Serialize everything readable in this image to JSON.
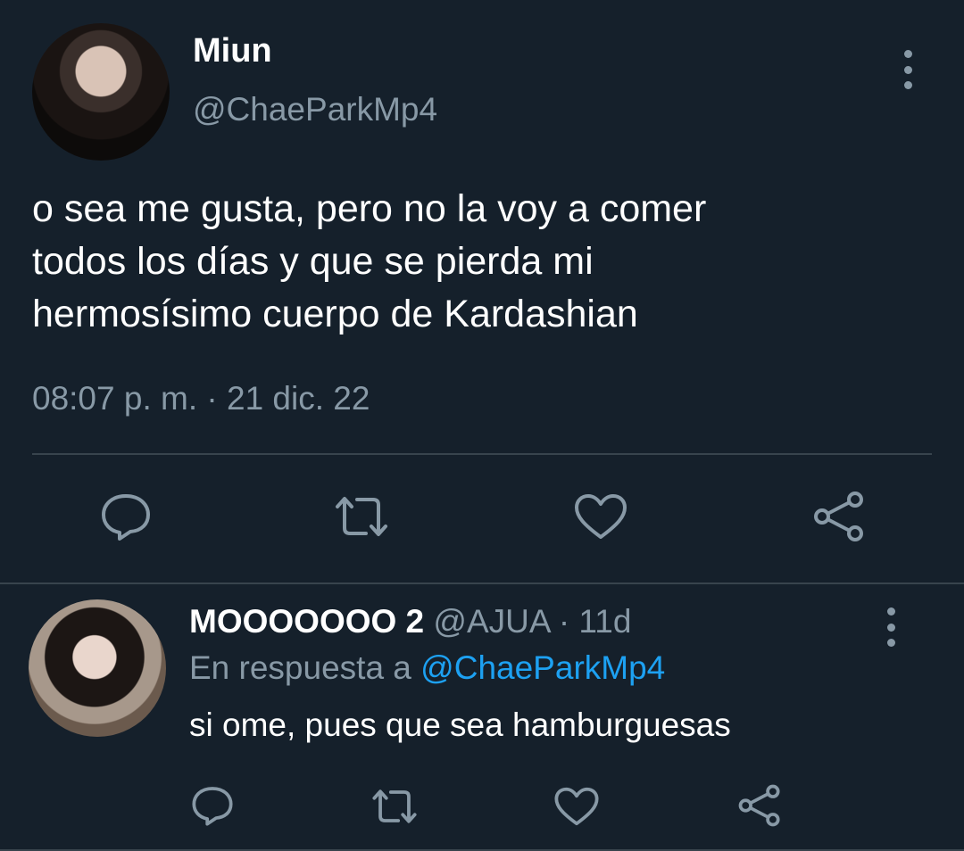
{
  "main_tweet": {
    "display_name": "Miun",
    "handle": "@ChaeParkMp4",
    "text_lines": [
      "o sea me gusta, pero no la voy a comer",
      "todos los días y que se pierda mi",
      "hermosísimo cuerpo de Kardashian"
    ],
    "timestamp": "08:07 p. m. · 21 dic. 22",
    "actions": [
      "reply-icon",
      "retweet-icon",
      "like-icon",
      "share-icon"
    ]
  },
  "reply_tweet": {
    "display_name": "MOOOOOOO 2",
    "handle": "@AJUA",
    "separator": "·",
    "time": "11d",
    "context_prefix": "En respuesta a",
    "context_mention": "@ChaeParkMp4",
    "text": "si ome, pues que sea hamburguesas",
    "actions": [
      "reply-icon",
      "retweet-icon",
      "like-icon",
      "share-icon"
    ]
  },
  "colors": {
    "background": "#15202b",
    "primary_text": "#ffffff",
    "secondary_text": "#8899a6",
    "accent": "#1da1f2",
    "divider": "#38444d"
  }
}
